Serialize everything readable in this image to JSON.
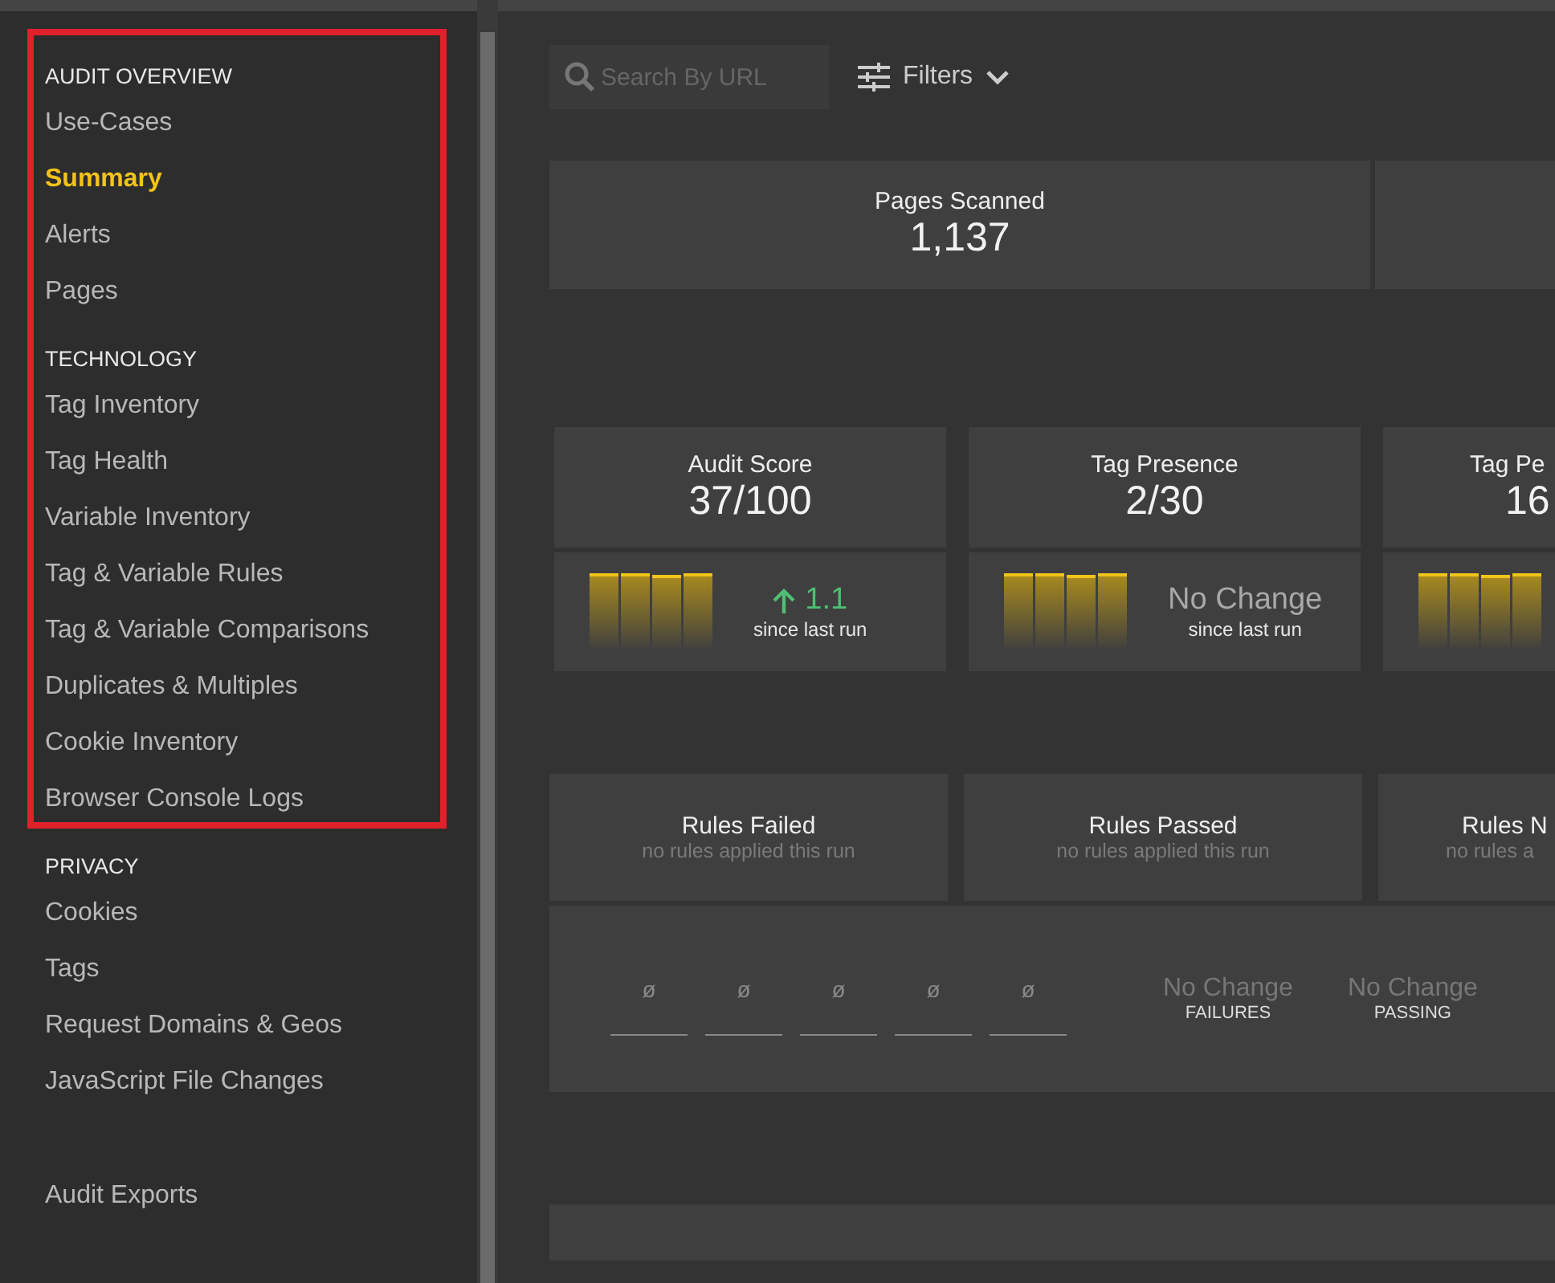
{
  "sidebar": {
    "sections": [
      {
        "title": "AUDIT OVERVIEW",
        "highlighted": true,
        "items": [
          {
            "label": "Use-Cases",
            "selected": false
          },
          {
            "label": "Summary",
            "selected": true
          },
          {
            "label": "Alerts",
            "selected": false
          },
          {
            "label": "Pages",
            "selected": false
          }
        ]
      },
      {
        "title": "TECHNOLOGY",
        "items": [
          {
            "label": "Tag Inventory",
            "selected": false
          },
          {
            "label": "Tag Health",
            "selected": false
          },
          {
            "label": "Variable Inventory",
            "selected": false
          },
          {
            "label": "Tag & Variable Rules",
            "selected": false
          },
          {
            "label": "Tag & Variable Comparisons",
            "selected": false
          },
          {
            "label": "Duplicates & Multiples",
            "selected": false
          },
          {
            "label": "Cookie Inventory",
            "selected": false
          },
          {
            "label": "Browser Console Logs",
            "selected": false
          }
        ]
      },
      {
        "title": "PRIVACY",
        "items": [
          {
            "label": "Cookies",
            "selected": false
          },
          {
            "label": "Tags",
            "selected": false
          },
          {
            "label": "Request Domains & Geos",
            "selected": false
          },
          {
            "label": "JavaScript File Changes",
            "selected": false
          }
        ]
      },
      {
        "items": [
          {
            "label": "Audit Exports",
            "selected": false
          }
        ]
      }
    ]
  },
  "toolbar": {
    "search": {
      "placeholder": "Search By URL"
    },
    "filters": "Filters"
  },
  "pages_scanned": {
    "label": "Pages Scanned",
    "value": "1,137"
  },
  "metrics": [
    {
      "label": "Audit Score",
      "value": "37/100",
      "trend": {
        "kind": "up",
        "value": "1.1",
        "note": "since last run"
      }
    },
    {
      "label": "Tag Presence",
      "value": "2/30",
      "trend": {
        "kind": "none",
        "value": "No Change",
        "note": "since last run"
      }
    },
    {
      "label": "Tag Pe",
      "value": "16"
    }
  ],
  "rules": [
    {
      "label": "Rules Failed",
      "note": "no rules applied this run"
    },
    {
      "label": "Rules Passed",
      "note": "no rules applied this run"
    },
    {
      "label": "Rules N",
      "note": "no rules a"
    }
  ],
  "rule_history": [
    "ø",
    "ø",
    "ø",
    "ø",
    "ø"
  ],
  "rule_changes": [
    {
      "value": "No Change",
      "label": "FAILURES"
    },
    {
      "value": "No Change",
      "label": "PASSING"
    }
  ]
}
